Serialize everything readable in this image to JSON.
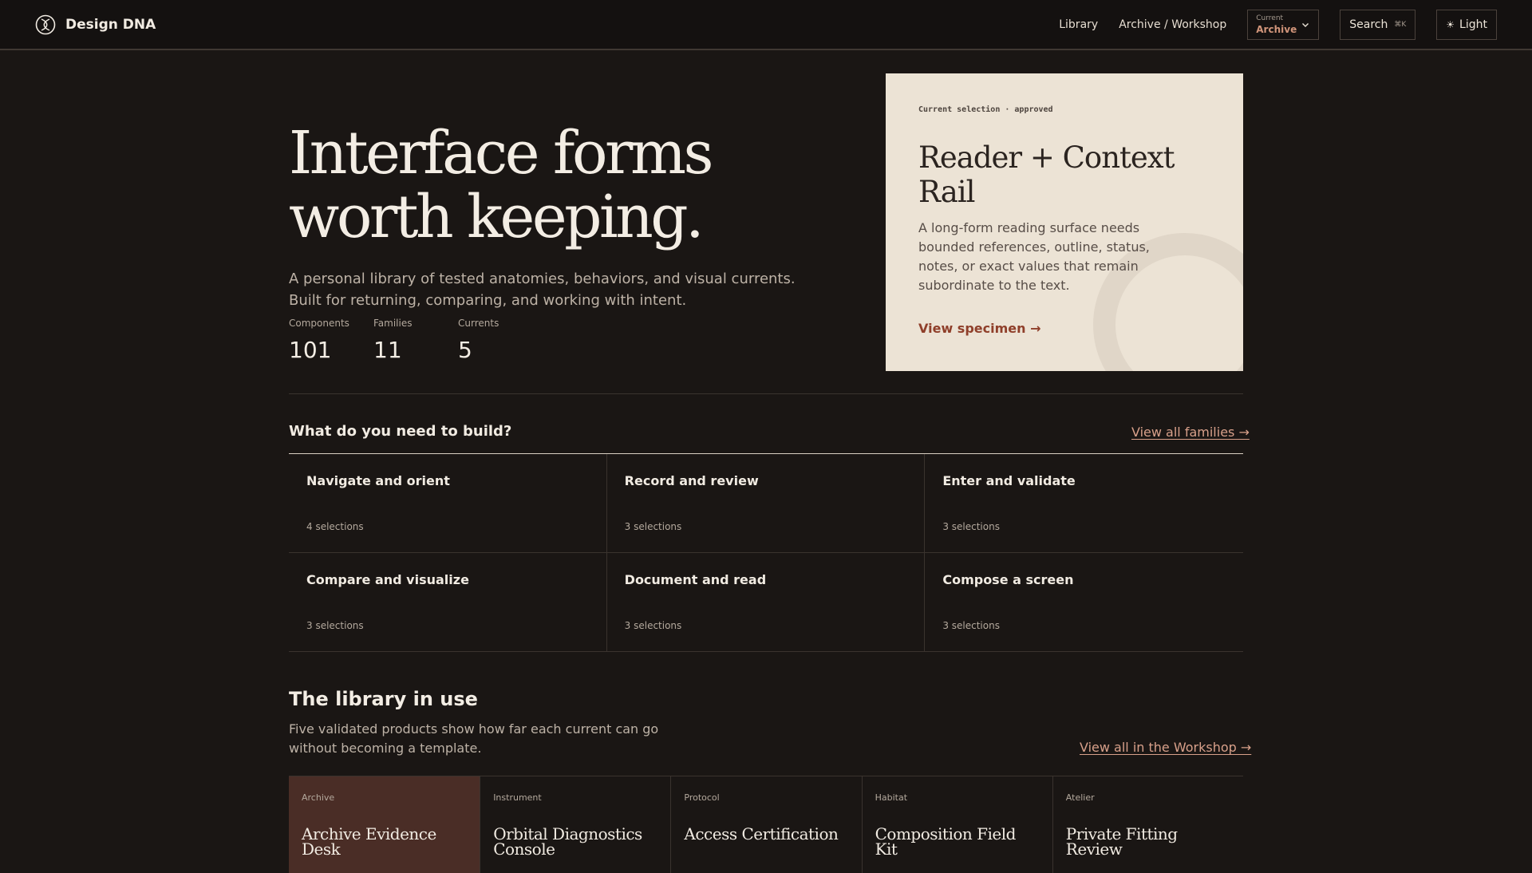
{
  "header": {
    "brand": "Design DNA",
    "nav": [
      "Library",
      "Archive / Workshop"
    ],
    "current_caption": "Current",
    "current_value": "Archive",
    "search_label": "Search",
    "search_shortcut": "⌘K",
    "theme_label": "Light"
  },
  "hero": {
    "title": "Interface forms worth keeping.",
    "description": "A personal library of tested anatomies, behaviors, and visual currents. Built for returning, comparing, and working with intent.",
    "stats": [
      {
        "label": "Components",
        "value": "101"
      },
      {
        "label": "Families",
        "value": "11"
      },
      {
        "label": "Currents",
        "value": "5"
      }
    ]
  },
  "feature": {
    "kicker": "Current selection · approved",
    "title": "Reader + Context Rail",
    "description": "A long-form reading surface needs bounded references, outline, status, notes, or exact values that remain subordinate to the text.",
    "link": "View specimen →"
  },
  "build": {
    "question": "What do you need to build?",
    "view_all": "View all families →",
    "cells": [
      {
        "title": "Navigate and orient",
        "count": "4 selections"
      },
      {
        "title": "Record and review",
        "count": "3 selections"
      },
      {
        "title": "Enter and validate",
        "count": "3 selections"
      },
      {
        "title": "Compare and visualize",
        "count": "3 selections"
      },
      {
        "title": "Document and read",
        "count": "3 selections"
      },
      {
        "title": "Compose a screen",
        "count": "3 selections"
      }
    ]
  },
  "library": {
    "title": "The library in use",
    "description": "Five validated products show how far each current can go without becoming a template.",
    "view_all": "View all in the Workshop →",
    "products": [
      {
        "current": "Archive",
        "name": "Archive Evidence Desk"
      },
      {
        "current": "Instrument",
        "name": "Orbital Diagnostics Console"
      },
      {
        "current": "Protocol",
        "name": "Access Certification"
      },
      {
        "current": "Habitat",
        "name": "Composition Field Kit"
      },
      {
        "current": "Atelier",
        "name": "Private Fitting Review"
      }
    ]
  }
}
